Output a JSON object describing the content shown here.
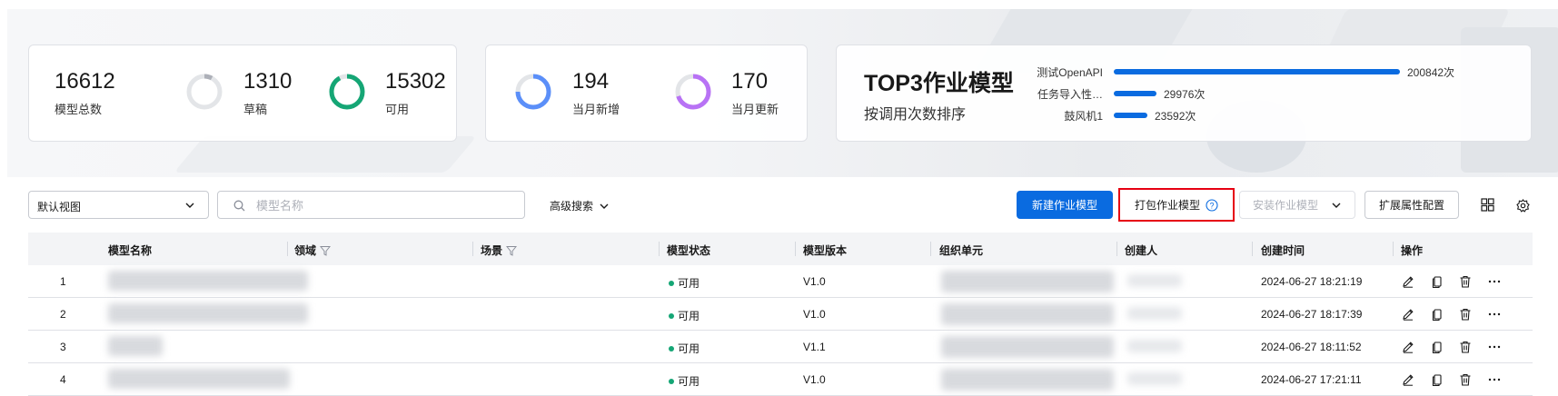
{
  "stats": {
    "total": {
      "value": "16612",
      "label": "模型总数"
    },
    "draft": {
      "value": "1310",
      "label": "草稿",
      "fraction": 0.079
    },
    "available": {
      "value": "15302",
      "label": "可用",
      "fraction": 0.921
    },
    "month_new": {
      "value": "194",
      "label": "当月新增"
    },
    "month_update": {
      "value": "170",
      "label": "当月更新"
    }
  },
  "top3": {
    "title": "TOP3作业模型",
    "subtitle": "按调用次数排序",
    "items": [
      {
        "name": "测试OpenAPI",
        "value": "200842次",
        "count": 200842
      },
      {
        "name": "任务导入性…",
        "value": "29976次",
        "count": 29976
      },
      {
        "name": "鼓风机1",
        "value": "23592次",
        "count": 23592
      }
    ]
  },
  "toolbar": {
    "view_select": "默认视图",
    "search_placeholder": "模型名称",
    "advanced_search": "高级搜索",
    "new_button": "新建作业模型",
    "pack_button": "打包作业模型",
    "install_button": "安装作业模型",
    "extend_button": "扩展属性配置"
  },
  "table": {
    "headers": [
      "模型名称",
      "领域",
      "场景",
      "模型状态",
      "模型版本",
      "组织单元",
      "创建人",
      "创建时间",
      "操作"
    ],
    "rows": [
      {
        "index": "1",
        "status": "可用",
        "version": "V1.0",
        "time": "2024-06-27 18:21:19"
      },
      {
        "index": "2",
        "status": "可用",
        "version": "V1.0",
        "time": "2024-06-27 18:17:39"
      },
      {
        "index": "3",
        "status": "可用",
        "version": "V1.1",
        "time": "2024-06-27 18:11:52"
      },
      {
        "index": "4",
        "status": "可用",
        "version": "V1.0",
        "time": "2024-06-27 17:21:11"
      }
    ]
  },
  "icons": {
    "edit": "edit-icon",
    "copy": "copy-icon",
    "delete": "delete-icon",
    "more": "more-icon",
    "grid": "grid-view-icon",
    "settings": "gear-icon",
    "search": "search-icon",
    "filter": "filter-icon",
    "help": "help-icon",
    "chevron": "chevron-down-icon"
  },
  "colors": {
    "primary": "#0a6be0",
    "available": "#15a675",
    "draft": "#adb0b8",
    "month_new": "#5b8ff9",
    "month_update": "#b872f5",
    "highlight": "#e60012"
  }
}
